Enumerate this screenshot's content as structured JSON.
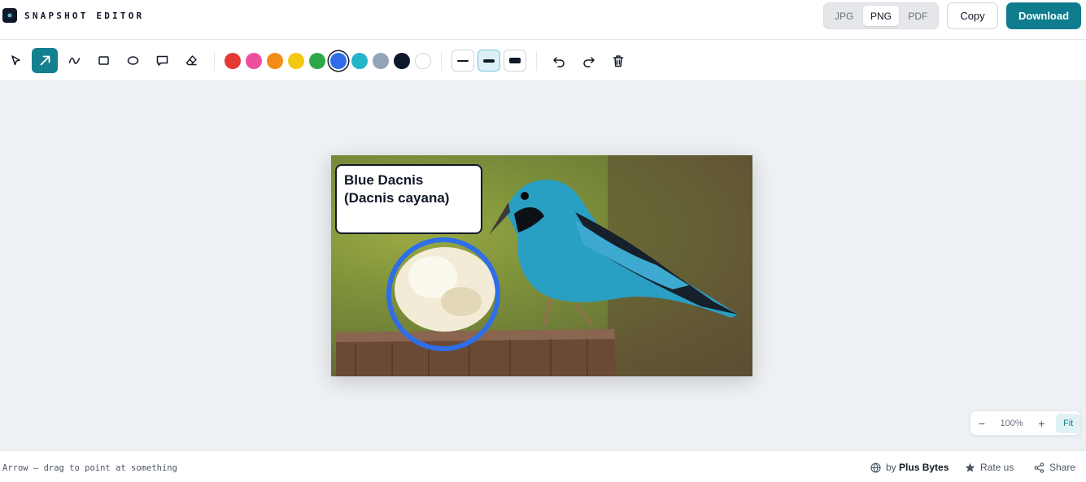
{
  "app": {
    "title": "SNAPSHOT EDITOR"
  },
  "export": {
    "formats": [
      "JPG",
      "PNG",
      "PDF"
    ],
    "selected_format": "PNG",
    "copy_label": "Copy",
    "download_label": "Download"
  },
  "toolbar": {
    "tools": [
      "select",
      "arrow",
      "freehand",
      "rectangle",
      "ellipse",
      "callout",
      "eraser"
    ],
    "active_tool": "arrow",
    "colors": [
      "#e53935",
      "#ec4f9d",
      "#f28c18",
      "#f2c811",
      "#2ea74b",
      "#2f6ee8",
      "#23b5c9",
      "#94a3b8",
      "#0f172a",
      "#ffffff"
    ],
    "selected_color": "#2f6ee8",
    "stroke_widths": [
      "thin",
      "medium",
      "thick"
    ],
    "selected_stroke": "medium",
    "actions": [
      "undo",
      "redo",
      "delete"
    ]
  },
  "canvas": {
    "callout_text": "Blue Dacnis (Dacnis cayana)",
    "highlight_color": "#2f6ee8"
  },
  "zoom": {
    "minus": "−",
    "value": "100%",
    "plus": "+",
    "fit": "Fit"
  },
  "footer": {
    "status": "Arrow — drag to point at something",
    "by_prefix": "by",
    "by_name": "Plus Bytes",
    "rate": "Rate us",
    "share": "Share"
  }
}
